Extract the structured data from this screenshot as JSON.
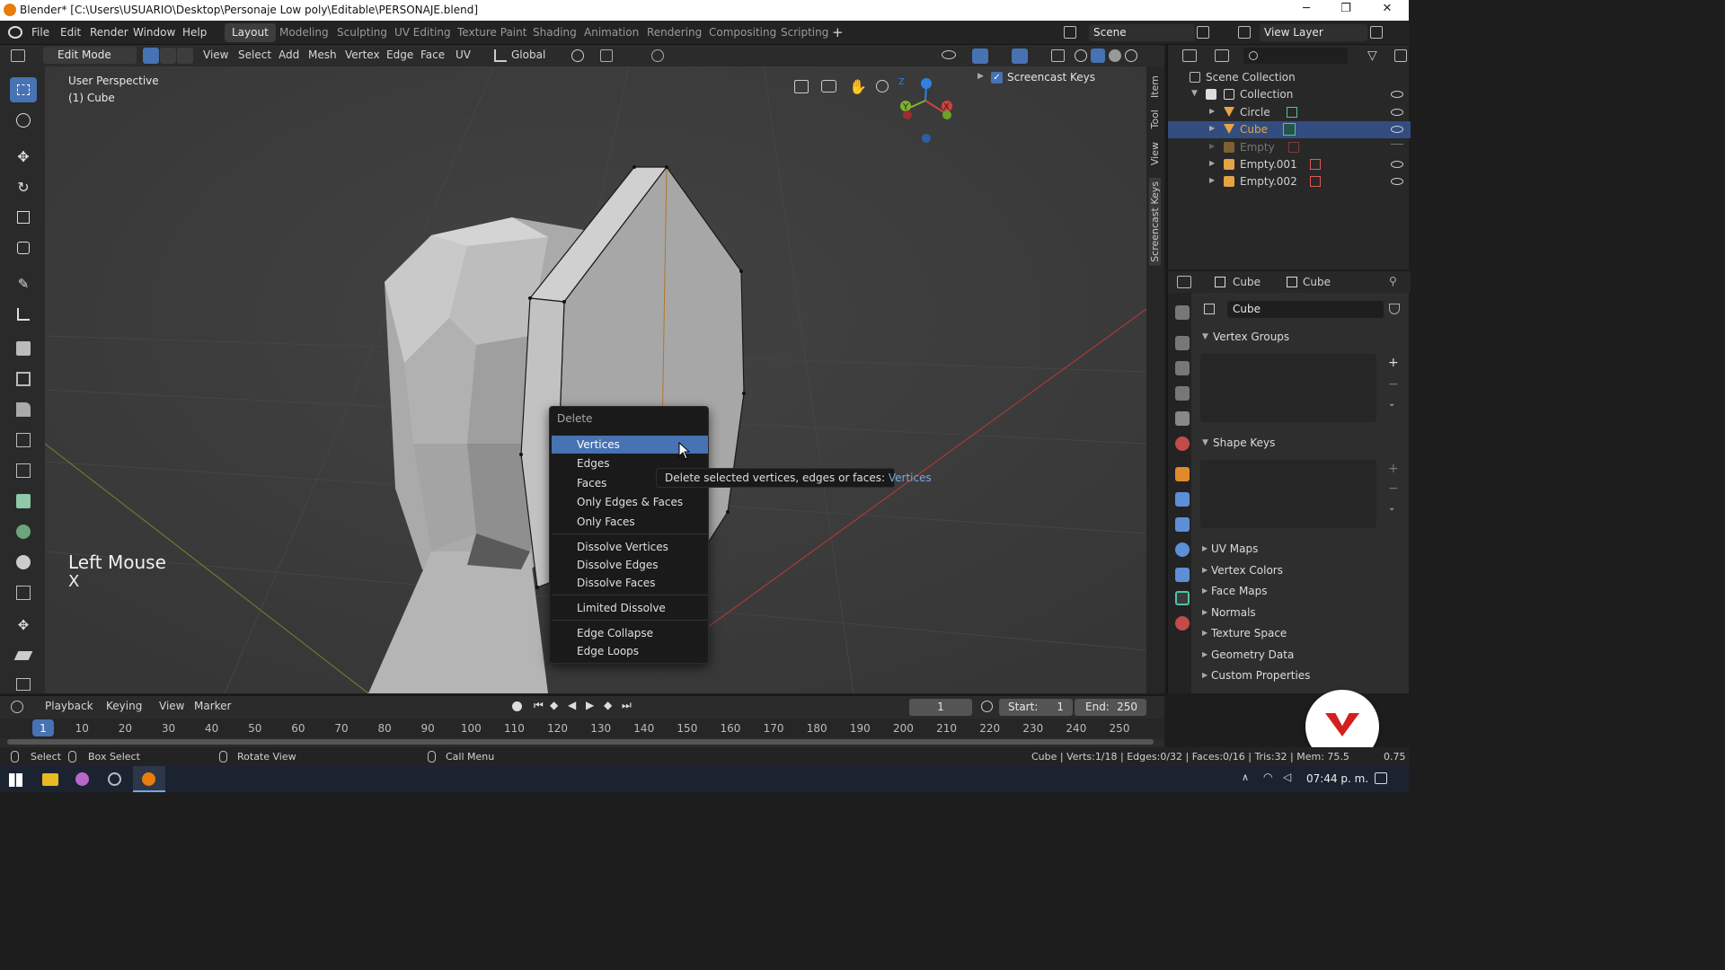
{
  "window": {
    "title": "Blender* [C:\\Users\\USUARIO\\Desktop\\Personaje Low poly\\Editable\\PERSONAJE.blend]"
  },
  "menubar": {
    "items": [
      "File",
      "Edit",
      "Render",
      "Window",
      "Help"
    ],
    "workspaces": [
      "Layout",
      "Modeling",
      "Sculpting",
      "UV Editing",
      "Texture Paint",
      "Shading",
      "Animation",
      "Rendering",
      "Compositing",
      "Scripting"
    ],
    "active_workspace": "Layout",
    "scene_label": "Scene",
    "view_layer_label": "View Layer"
  },
  "header3d": {
    "mode": "Edit Mode",
    "menus": [
      "View",
      "Select",
      "Add",
      "Mesh",
      "Vertex",
      "Edge",
      "Face",
      "UV"
    ],
    "transform_orientation": "Global"
  },
  "viewport": {
    "perspective_label": "User Perspective",
    "object_label": "(1) Cube",
    "screencast_keys_label": "Screencast Keys",
    "screencast_line1": "Left Mouse",
    "screencast_line2": "X",
    "gizmo_axes": [
      "Z",
      "Y",
      "X"
    ]
  },
  "npanel_tabs": [
    "Item",
    "Tool",
    "View",
    "Screencast Keys"
  ],
  "delete_menu": {
    "title": "Delete",
    "items": [
      "Vertices",
      "Edges",
      "Faces",
      "Only Edges & Faces",
      "Only Faces",
      "Dissolve Vertices",
      "Dissolve Edges",
      "Dissolve Faces",
      "Limited Dissolve",
      "Edge Collapse",
      "Edge Loops"
    ],
    "active_item": "Vertices"
  },
  "tooltip": {
    "text": "Delete selected vertices, edges or faces:",
    "value": "Vertices"
  },
  "outliner": {
    "scene_collection": "Scene Collection",
    "collection": "Collection",
    "objects": [
      {
        "name": "Circle",
        "active": false,
        "dimmed": false
      },
      {
        "name": "Cube",
        "active": true,
        "dimmed": false
      },
      {
        "name": "Empty",
        "active": false,
        "dimmed": true
      },
      {
        "name": "Empty.001",
        "active": false,
        "dimmed": false
      },
      {
        "name": "Empty.002",
        "active": false,
        "dimmed": false
      }
    ]
  },
  "properties": {
    "breadcrumb_object": "Cube",
    "breadcrumb_mesh": "Cube",
    "mesh_name": "Cube",
    "panels_open": [
      "Vertex Groups",
      "Shape Keys"
    ],
    "panels_closed": [
      "UV Maps",
      "Vertex Colors",
      "Face Maps",
      "Normals",
      "Texture Space",
      "Geometry Data",
      "Custom Properties"
    ]
  },
  "timeline": {
    "menus": [
      "Playback",
      "Keying",
      "View",
      "Marker"
    ],
    "current_frame": "1",
    "start_label": "Start:",
    "start": "1",
    "end_label": "End:",
    "end": "250",
    "ticks": [
      "1",
      "10",
      "20",
      "30",
      "40",
      "50",
      "60",
      "70",
      "80",
      "90",
      "100",
      "110",
      "120",
      "130",
      "140",
      "150",
      "160",
      "170",
      "180",
      "190",
      "200",
      "210",
      "220",
      "230",
      "240",
      "250"
    ]
  },
  "statusbar": {
    "select": "Select",
    "box_select": "Box Select",
    "rotate_view": "Rotate View",
    "call_menu": "Call Menu",
    "stats": "Cube | Verts:1/18 | Edges:0/32 | Faces:0/16 | Tris:32 | Mem: 75.5",
    "stats_tail": "0.75"
  },
  "taskbar": {
    "time": "07:44 p. m."
  },
  "colors": {
    "accent": "#4772b3",
    "active_object": "#e6a443",
    "axis_x": "#d2403f",
    "axis_y": "#7bb32e",
    "axis_z": "#2f80e0"
  }
}
